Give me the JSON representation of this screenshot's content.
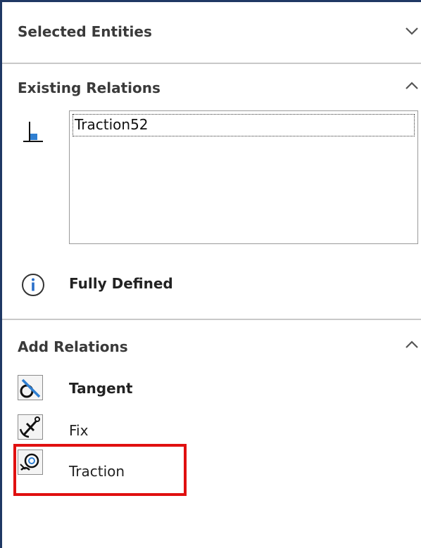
{
  "panel": {
    "accent_color": "#1f3864",
    "highlight_color": "#e01010"
  },
  "selected_entities": {
    "title": "Selected Entities",
    "state": "collapsed",
    "chevron_icon": "chevron-down-icon"
  },
  "existing_relations": {
    "title": "Existing Relations",
    "state": "expanded",
    "chevron_icon": "chevron-up-icon",
    "relation_type_icon": "fixed-relation-icon",
    "items": [
      "Traction52"
    ],
    "status_icon": "info-icon",
    "status": "Fully Defined"
  },
  "add_relations": {
    "title": "Add Relations",
    "state": "expanded",
    "chevron_icon": "chevron-up-icon",
    "buttons": [
      {
        "label": "Tangent",
        "icon": "tangent-icon",
        "bold": true
      },
      {
        "label": "Fix",
        "icon": "fix-anchor-icon",
        "bold": false
      },
      {
        "label": "Traction",
        "icon": "traction-icon",
        "bold": false,
        "highlighted": true
      }
    ]
  }
}
